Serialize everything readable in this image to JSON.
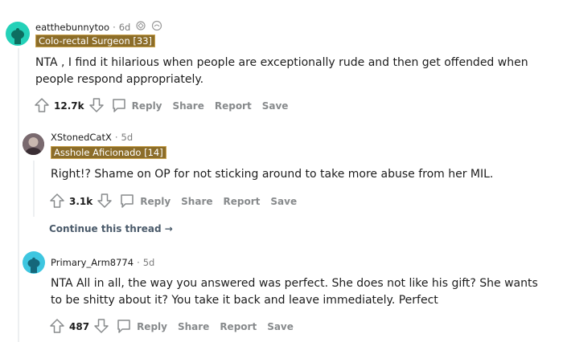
{
  "comments": [
    {
      "author": "eatthebunnytoo",
      "time": "6d",
      "flair": "Colo-rectal Surgeon [33]",
      "body": "NTA , I find it hilarious when people are exceptionally rude and then get offended when people respond appropriately.",
      "score": "12.7k"
    },
    {
      "author": "XStonedCatX",
      "time": "5d",
      "flair": "Asshole Aficionado [14]",
      "body": "Right!? Shame on OP for not sticking around to take more abuse from her MIL.",
      "score": "3.1k"
    },
    {
      "author": "Primary_Arm8774",
      "time": "5d",
      "flair": "",
      "body": "NTA All in all, the way you answered was perfect. She does not like his gift? She wants to be shitty about it? You take it back and leave immediately. Perfect",
      "score": "487"
    }
  ],
  "actions": {
    "reply": "Reply",
    "share": "Share",
    "report": "Report",
    "save": "Save"
  },
  "continue_thread": "Continue this thread",
  "separator": "·",
  "continue_arrow": "→",
  "colors": {
    "flair_bg": "#8c6d29",
    "avatar_teal": "#24d1b8",
    "avatar_cyan": "#3ec6e0",
    "meta_gray": "#7c7c7c",
    "action_gray": "#878a8c"
  },
  "icons": [
    "upvote-icon",
    "downvote-icon",
    "reply-icon",
    "award-icon"
  ]
}
